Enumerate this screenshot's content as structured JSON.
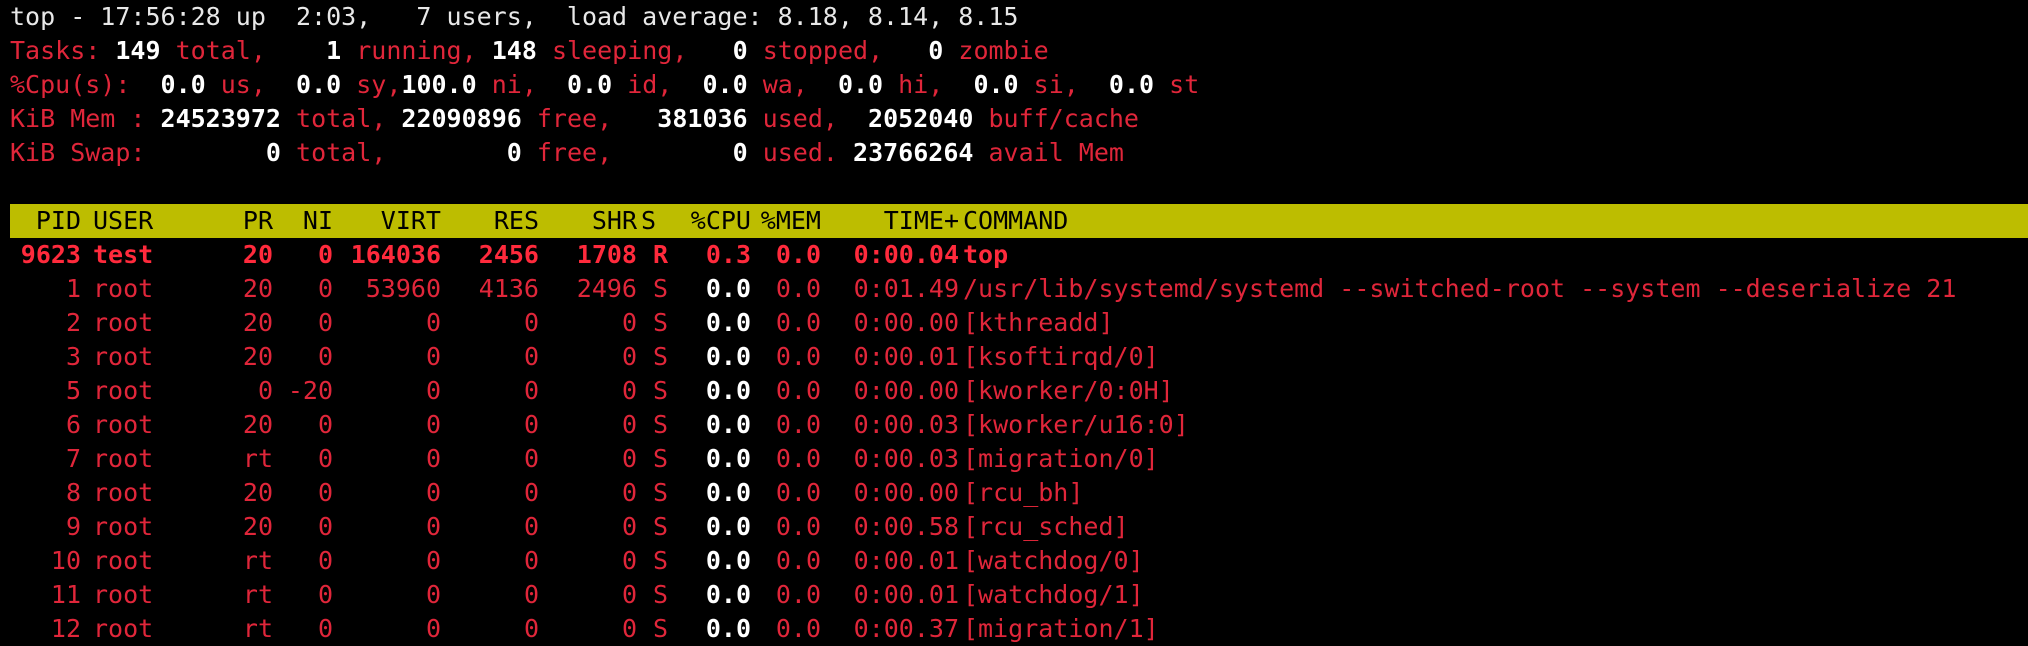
{
  "summary": {
    "line1": "top - 17:56:28 up  2:03,   7 users,  load average: 8.18, 8.14, 8.15",
    "tasks": {
      "label": "Tasks:",
      "total": "149",
      "total_label": "total,",
      "running": "1",
      "running_label": "running,",
      "sleeping": "148",
      "sleeping_label": "sleeping,",
      "stopped": "0",
      "stopped_label": "stopped,",
      "zombie": "0",
      "zombie_label": "zombie"
    },
    "cpu": {
      "label": "%Cpu(s):",
      "us": "0.0",
      "us_label": "us,",
      "sy": "0.0",
      "sy_label": "sy,",
      "ni": "100.0",
      "ni_label": "ni,",
      "id": "0.0",
      "id_label": "id,",
      "wa": "0.0",
      "wa_label": "wa,",
      "hi": "0.0",
      "hi_label": "hi,",
      "si": "0.0",
      "si_label": "si,",
      "st": "0.0",
      "st_label": "st"
    },
    "mem": {
      "label": "KiB Mem :",
      "total": "24523972",
      "total_label": "total,",
      "free": "22090896",
      "free_label": "free,",
      "used": "381036",
      "used_label": "used,",
      "buff": "2052040",
      "buff_label": "buff/cache"
    },
    "swap": {
      "label": "KiB Swap:",
      "total": "0",
      "total_label": "total,",
      "free": "0",
      "free_label": "free,",
      "used": "0",
      "used_label": "used.",
      "avail": "23766264",
      "avail_label": "avail Mem"
    }
  },
  "columns": [
    "PID",
    "USER",
    "PR",
    "NI",
    "VIRT",
    "RES",
    "SHR",
    "S",
    "%CPU",
    "%MEM",
    "TIME+",
    "COMMAND"
  ],
  "processes": [
    {
      "pid": "9623",
      "user": "test",
      "pr": "20",
      "ni": "0",
      "virt": "164036",
      "res": "2456",
      "shr": "1708",
      "s": "R",
      "cpu": "0.3",
      "mem": "0.0",
      "time": "0:00.04",
      "cmd": "top"
    },
    {
      "pid": "1",
      "user": "root",
      "pr": "20",
      "ni": "0",
      "virt": "53960",
      "res": "4136",
      "shr": "2496",
      "s": "S",
      "cpu": "0.0",
      "mem": "0.0",
      "time": "0:01.49",
      "cmd": "/usr/lib/systemd/systemd --switched-root --system --deserialize 21"
    },
    {
      "pid": "2",
      "user": "root",
      "pr": "20",
      "ni": "0",
      "virt": "0",
      "res": "0",
      "shr": "0",
      "s": "S",
      "cpu": "0.0",
      "mem": "0.0",
      "time": "0:00.00",
      "cmd": "[kthreadd]"
    },
    {
      "pid": "3",
      "user": "root",
      "pr": "20",
      "ni": "0",
      "virt": "0",
      "res": "0",
      "shr": "0",
      "s": "S",
      "cpu": "0.0",
      "mem": "0.0",
      "time": "0:00.01",
      "cmd": "[ksoftirqd/0]"
    },
    {
      "pid": "5",
      "user": "root",
      "pr": "0",
      "ni": "-20",
      "virt": "0",
      "res": "0",
      "shr": "0",
      "s": "S",
      "cpu": "0.0",
      "mem": "0.0",
      "time": "0:00.00",
      "cmd": "[kworker/0:0H]"
    },
    {
      "pid": "6",
      "user": "root",
      "pr": "20",
      "ni": "0",
      "virt": "0",
      "res": "0",
      "shr": "0",
      "s": "S",
      "cpu": "0.0",
      "mem": "0.0",
      "time": "0:00.03",
      "cmd": "[kworker/u16:0]"
    },
    {
      "pid": "7",
      "user": "root",
      "pr": "rt",
      "ni": "0",
      "virt": "0",
      "res": "0",
      "shr": "0",
      "s": "S",
      "cpu": "0.0",
      "mem": "0.0",
      "time": "0:00.03",
      "cmd": "[migration/0]"
    },
    {
      "pid": "8",
      "user": "root",
      "pr": "20",
      "ni": "0",
      "virt": "0",
      "res": "0",
      "shr": "0",
      "s": "S",
      "cpu": "0.0",
      "mem": "0.0",
      "time": "0:00.00",
      "cmd": "[rcu_bh]"
    },
    {
      "pid": "9",
      "user": "root",
      "pr": "20",
      "ni": "0",
      "virt": "0",
      "res": "0",
      "shr": "0",
      "s": "S",
      "cpu": "0.0",
      "mem": "0.0",
      "time": "0:00.58",
      "cmd": "[rcu_sched]"
    },
    {
      "pid": "10",
      "user": "root",
      "pr": "rt",
      "ni": "0",
      "virt": "0",
      "res": "0",
      "shr": "0",
      "s": "S",
      "cpu": "0.0",
      "mem": "0.0",
      "time": "0:00.01",
      "cmd": "[watchdog/0]"
    },
    {
      "pid": "11",
      "user": "root",
      "pr": "rt",
      "ni": "0",
      "virt": "0",
      "res": "0",
      "shr": "0",
      "s": "S",
      "cpu": "0.0",
      "mem": "0.0",
      "time": "0:00.01",
      "cmd": "[watchdog/1]"
    },
    {
      "pid": "12",
      "user": "root",
      "pr": "rt",
      "ni": "0",
      "virt": "0",
      "res": "0",
      "shr": "0",
      "s": "S",
      "cpu": "0.0",
      "mem": "0.0",
      "time": "0:00.37",
      "cmd": "[migration/1]"
    }
  ],
  "colors": {
    "label": "#e0263a",
    "value": "#ffffff",
    "header_bg": "#bdbd00",
    "background": "#000000"
  }
}
